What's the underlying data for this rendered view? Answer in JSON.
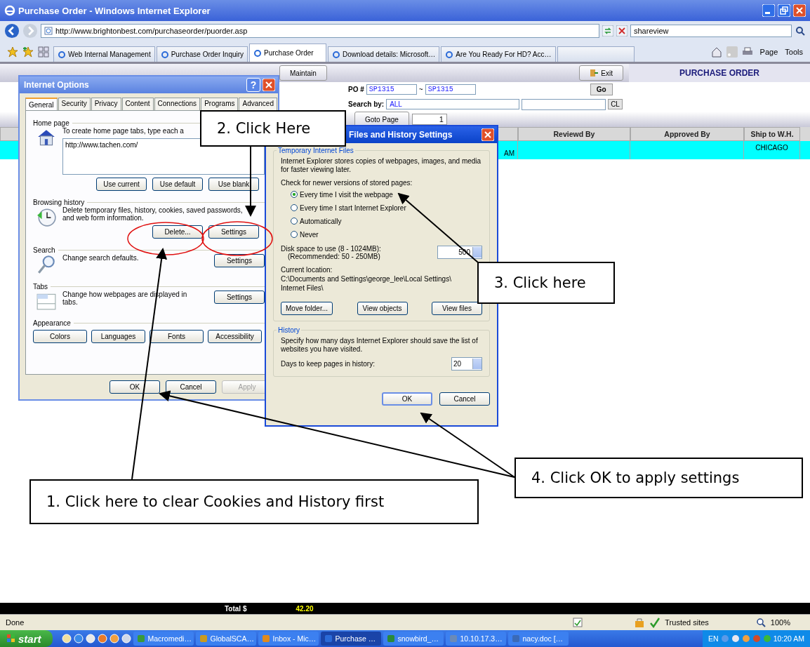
{
  "window": {
    "title": "Purchase Order - Windows Internet Explorer"
  },
  "address_bar": {
    "url": "http://www.brightonbest.com/purchaseorder/puorder.asp",
    "search": "shareview"
  },
  "tabs": [
    {
      "label": "Web Internal Management",
      "selected": false
    },
    {
      "label": "Purchase Order Inquiry",
      "selected": false
    },
    {
      "label": "Purchase Order",
      "selected": true
    },
    {
      "label": "Download details: Microsoft…",
      "selected": false
    },
    {
      "label": "Are You Ready For HD? Acc…",
      "selected": false
    }
  ],
  "command_bar": [
    "Page",
    "Tools"
  ],
  "page": {
    "maintain_button": "Maintain",
    "exit_button": "Exit",
    "heading": "PURCHASE ORDER",
    "po": {
      "label": "PO #",
      "from": "SP1315",
      "separator": "~",
      "to": "SP1315",
      "go": "Go"
    },
    "search": {
      "label": "Search by:",
      "value": "ALL",
      "clear": "CL"
    },
    "goto": {
      "button": "Goto Page",
      "value": "1"
    },
    "table": {
      "columns": [
        "Reviewd By",
        "Approved By",
        "Ship to W.H."
      ],
      "rows": [
        {
          "cell_1": "AM",
          "ship_to": "CHICAGO",
          "selected": true
        }
      ]
    },
    "total": {
      "label": "Total $",
      "value": "42.20"
    }
  },
  "internet_options": {
    "title": "Internet Options",
    "help": "?",
    "tabs": [
      {
        "label": "General",
        "selected": true
      },
      {
        "label": "Security",
        "selected": false
      },
      {
        "label": "Privacy",
        "selected": false
      },
      {
        "label": "Content",
        "selected": false
      },
      {
        "label": "Connections",
        "selected": false
      },
      {
        "label": "Programs",
        "selected": false
      },
      {
        "label": "Advanced",
        "selected": false
      }
    ],
    "sections": [
      {
        "kind": "home",
        "heading": "Home page",
        "text": "To create home page tabs, type each a",
        "value": "http://www.tachen.com/",
        "buttons": [
          "Use current",
          "Use default",
          "Use blank"
        ]
      },
      {
        "kind": "history",
        "heading": "Browsing history",
        "text": "Delete temporary files, history, cookies, saved passwords, and web form information.",
        "buttons": [
          "Delete...",
          "Settings"
        ]
      },
      {
        "kind": "search",
        "heading": "Search",
        "text": "Change search defaults.",
        "buttons": [
          "Settings"
        ]
      },
      {
        "kind": "tabs",
        "heading": "Tabs",
        "text": "Change how webpages are displayed in tabs.",
        "buttons": [
          "Settings"
        ]
      },
      {
        "kind": "appearance",
        "heading": "Appearance",
        "buttons": [
          "Colors",
          "Languages",
          "Fonts",
          "Accessibility"
        ]
      }
    ],
    "footer": [
      {
        "label": "OK",
        "disabled": false
      },
      {
        "label": "Cancel",
        "disabled": false
      },
      {
        "label": "Apply",
        "disabled": true
      }
    ]
  },
  "cache_settings": {
    "title": "Files and History Settings",
    "temp_group": {
      "heading": "Temporary Internet Files",
      "description": "Internet Explorer stores copies of webpages, images, and media for faster viewing later.",
      "check_label": "Check for newer versions of stored pages:",
      "options": [
        {
          "label": "Every time I visit the webpage",
          "selected": true
        },
        {
          "label": "Every time I start Internet Explorer",
          "selected": false
        },
        {
          "label": "Automatically",
          "selected": false
        },
        {
          "label": "Never",
          "selected": false
        }
      ],
      "disk_label": "Disk space to use (8 - 1024MB):",
      "disk_hint": "(Recommended: 50 - 250MB)",
      "disk_value": "500",
      "location_label": "Current location:",
      "location": [
        "C:\\Documents and Settings\\george_lee\\Local Settings\\",
        "Internet Files\\"
      ],
      "buttons": [
        "Move folder...",
        "View objects",
        "View files"
      ]
    },
    "history_group": {
      "heading": "History",
      "description": "Specify how many days Internet Explorer should save the list of websites you have visited.",
      "days_label": "Days to keep pages in history:",
      "days_value": "20"
    },
    "buttons": [
      "OK",
      "Cancel"
    ]
  },
  "callouts": [
    {
      "text": "2. Click Here"
    },
    {
      "text": "3. Click here"
    },
    {
      "text": "4. Click OK to apply settings"
    },
    {
      "text": "1. Click here to clear Cookies and History first"
    }
  ],
  "status_bar": {
    "text": "Done",
    "zone": "Trusted sites",
    "zoom": "100%"
  },
  "taskbar": {
    "start": "start",
    "tasks": [
      {
        "label": "Macromedi…",
        "selected": false
      },
      {
        "label": "GlobalSCA…",
        "selected": false
      },
      {
        "label": "Inbox - Mic…",
        "selected": false
      },
      {
        "label": "Purchase …",
        "selected": true
      },
      {
        "label": "snowbird_…",
        "selected": false
      },
      {
        "label": "10.10.17.3…",
        "selected": false
      },
      {
        "label": "nacy.doc […",
        "selected": false
      }
    ],
    "language": "EN",
    "clock": "10:20 AM"
  }
}
